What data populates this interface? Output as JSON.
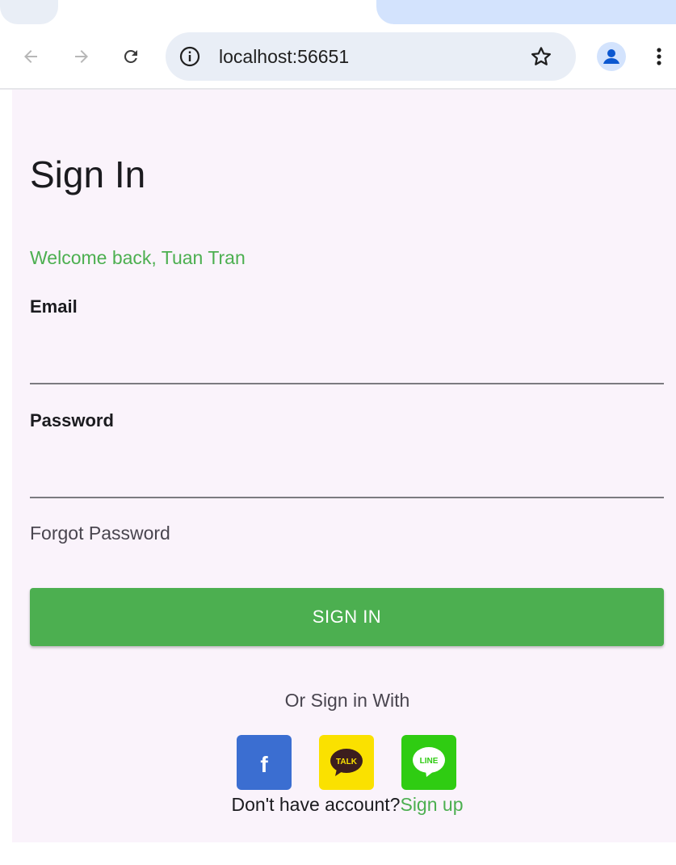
{
  "browser": {
    "url": "localhost:56651"
  },
  "page": {
    "title": "Sign In",
    "welcome": "Welcome back, Tuan Tran",
    "email": {
      "label": "Email",
      "value": ""
    },
    "password": {
      "label": "Password",
      "value": ""
    },
    "forgot_password": "Forgot Password",
    "sign_in_button": "SIGN IN",
    "or_sign_in_with": "Or Sign in With",
    "social": [
      {
        "name": "facebook",
        "glyph": "f",
        "color": "#3b6ed1"
      },
      {
        "name": "kakaotalk",
        "glyph": "TALK",
        "color": "#fae100"
      },
      {
        "name": "line",
        "glyph": "LINE",
        "color": "#2fcc12"
      }
    ],
    "no_account": "Don't have account?",
    "sign_up": "Sign up"
  },
  "colors": {
    "accent": "#4caf50",
    "page_background": "#faf3fb"
  }
}
